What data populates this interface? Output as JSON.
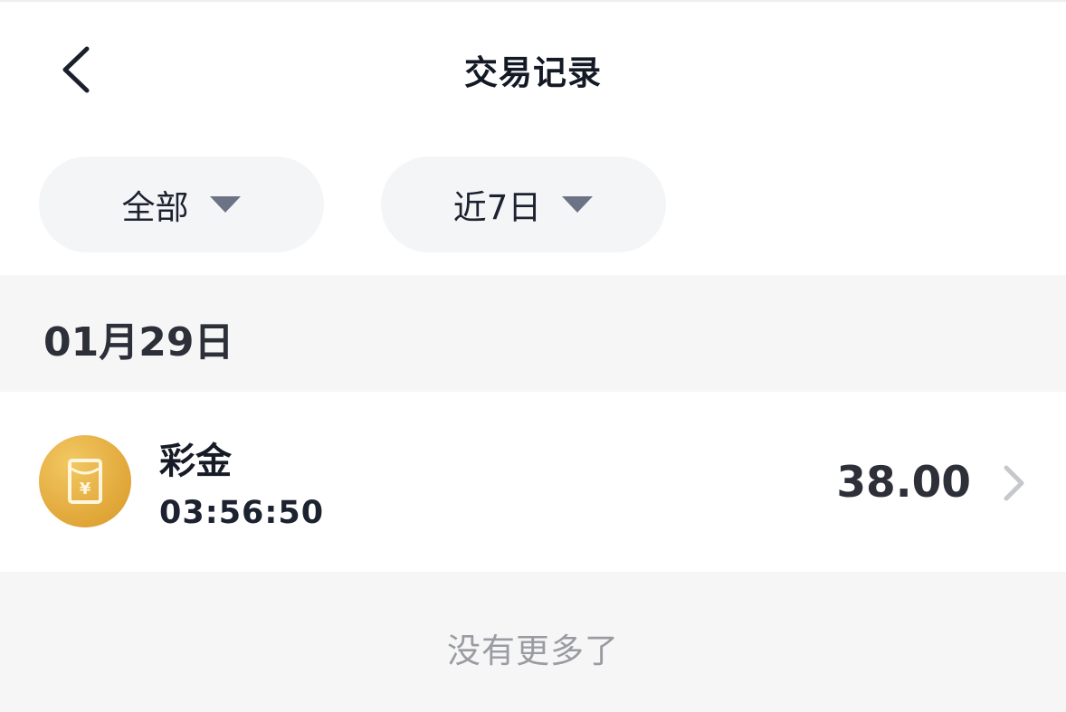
{
  "header": {
    "title": "交易记录",
    "back_icon": "chevron-left-icon"
  },
  "filters": [
    {
      "label": "全部",
      "icon": "caret-down-icon"
    },
    {
      "label": "近7日",
      "icon": "caret-down-icon"
    }
  ],
  "date_group": {
    "date": "01月29日"
  },
  "transactions": [
    {
      "name": "彩金",
      "time": "03:56:50",
      "amount": "38.00",
      "icon": "red-packet-icon",
      "chevron": "chevron-right-icon"
    }
  ],
  "footer": {
    "text": "没有更多了"
  },
  "colors": {
    "icon_gold": "#e0a638",
    "caret": "#6b7385",
    "chevron": "#c6c8cc",
    "band_bg": "#f6f6f7",
    "filter_bg": "#f4f5f7"
  }
}
